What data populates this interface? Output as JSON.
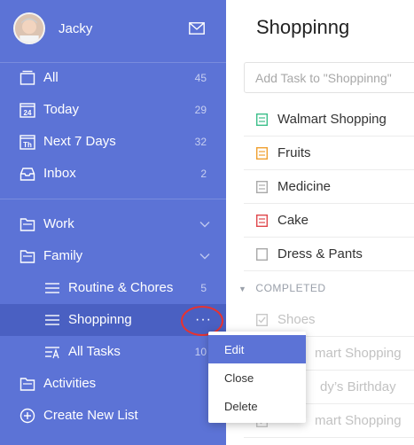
{
  "profile": {
    "name": "Jacky"
  },
  "smart_lists": [
    {
      "label": "All",
      "count": "45",
      "icon": "all-list-icon"
    },
    {
      "label": "Today",
      "count": "29",
      "icon": "calendar-today-icon",
      "icon_text": "24"
    },
    {
      "label": "Next 7 Days",
      "count": "32",
      "icon": "calendar-week-icon",
      "icon_text": "Th"
    },
    {
      "label": "Inbox",
      "count": "2",
      "icon": "inbox-icon"
    }
  ],
  "folders": [
    {
      "label": "Work",
      "icon": "folder-icon"
    },
    {
      "label": "Family",
      "icon": "folder-icon"
    }
  ],
  "family_lists": [
    {
      "label": "Routine & Chores",
      "count": "5"
    },
    {
      "label": "Shoppinng",
      "more": "···"
    },
    {
      "label": "All Tasks",
      "count": "10"
    }
  ],
  "bottom_nav": {
    "activities": "Activities",
    "create_list": "Create New List"
  },
  "main": {
    "title": "Shoppinng",
    "add_task_placeholder": "Add Task to \"Shoppinng\"",
    "tasks": [
      {
        "label": "Walmart Shopping",
        "color": "#3cbf8a"
      },
      {
        "label": "Fruits",
        "color": "#f0a030"
      },
      {
        "label": "Medicine",
        "color": "#a9a9a9"
      },
      {
        "label": "Cake",
        "color": "#e0474c"
      },
      {
        "label": "Dress & Pants",
        "color": "#a9a9a9"
      }
    ],
    "completed_header": "COMPLETED",
    "completed_tasks": [
      {
        "label": "Shoes"
      },
      {
        "label": "mart Shopping"
      },
      {
        "label": "dy’s Birthday"
      },
      {
        "label": "mart Shopping"
      }
    ]
  },
  "context_menu": {
    "items": [
      "Edit",
      "Close",
      "Delete"
    ],
    "active": "Edit"
  },
  "colors": {
    "sidebar": "#5c73d6",
    "sidebar_selected": "#4a60c2",
    "highlight_circle": "#e8322f"
  }
}
